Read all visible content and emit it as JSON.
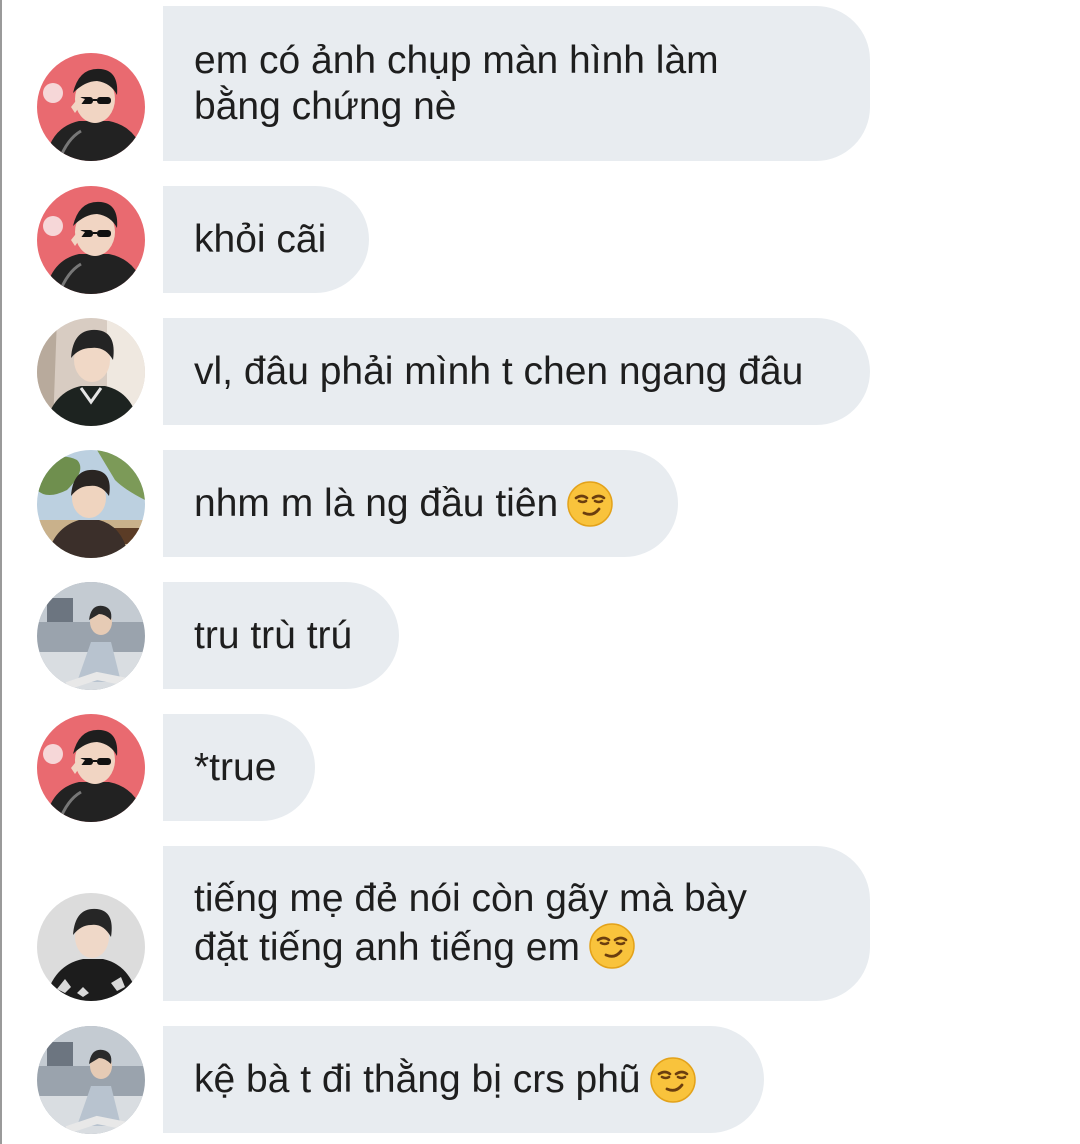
{
  "messages": [
    {
      "avatar": "avatar-red-sunglasses",
      "text": "em có ảnh chụp màn hình làm\nbằng chứng nè",
      "emoji": null
    },
    {
      "avatar": "avatar-red-sunglasses",
      "text": "khỏi cãi",
      "emoji": null
    },
    {
      "avatar": "avatar-dark-jacket",
      "text": "vl, đâu phải mình t chen ngang đâu",
      "emoji": null
    },
    {
      "avatar": "avatar-outdoor-tree",
      "text": "nhm m là ng đầu tiên",
      "emoji": "smirking-face"
    },
    {
      "avatar": "avatar-sitting-grey",
      "text": "tru trù trú",
      "emoji": null
    },
    {
      "avatar": "avatar-red-sunglasses",
      "text": "*true",
      "emoji": null
    },
    {
      "avatar": "avatar-patterned-jacket",
      "text": "tiếng mẹ đẻ nói còn gãy mà bày\nđặt tiếng anh tiếng em",
      "emoji": "smirking-face"
    },
    {
      "avatar": "avatar-sitting-grey",
      "text": "kệ bà t đi thằng bị crs phũ",
      "emoji": "smirking-face"
    }
  ],
  "colors": {
    "bubble_background": "#e8ecf0",
    "text": "#1e1e1e"
  }
}
